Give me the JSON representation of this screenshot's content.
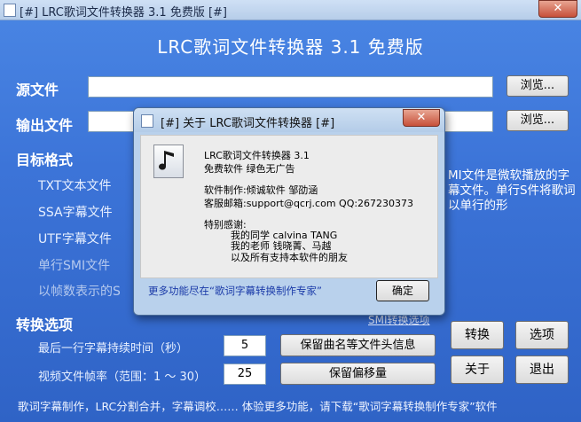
{
  "window": {
    "title": "[#] LRC歌词文件转换器 3.1 免费版 [#]",
    "close_glyph": "✕"
  },
  "app_title": "LRC歌词文件转换器 3.1 免费版",
  "source": {
    "label": "源文件",
    "value": "",
    "browse": "浏览..."
  },
  "output": {
    "label": "输出文件",
    "value": "",
    "browse": "浏览..."
  },
  "target": {
    "label": "目标格式",
    "options": [
      "TXT文本文件",
      "SSA字幕文件",
      "UTF字幕文件",
      "单行SMI文件",
      "以帧数表示的S"
    ]
  },
  "description": "MI文件是微软播放的字幕文件。单行S件将歌词以单行的形",
  "convert_options": {
    "label": "转换选项",
    "smi_link": "SMI转换选项",
    "last_line_label": "最后一行字幕持续时间（秒）",
    "last_line_value": "5",
    "keep_header": "保留曲名等文件头信息",
    "fps_label": "视频文件帧率（范围：1 ～ 30）",
    "fps_value": "25",
    "keep_offset": "保留偏移量"
  },
  "buttons": {
    "convert": "转换",
    "options": "选项",
    "about": "关于",
    "exit": "退出"
  },
  "status_bar": "歌词字幕制作，LRC分割合并，字幕调校…… 体验更多功能，请下载“歌词字幕转换制作专家”软件",
  "dialog": {
    "title": "[#] 关于 LRC歌词文件转换器 [#]",
    "close_glyph": "✕",
    "line1": "LRC歌词文件转换器 3.1",
    "line2": "免费软件 绿色无广告",
    "author": "软件制作:倾诚软件 邹劭涵",
    "contact": "客服邮箱:support@qcrj.com  QQ:267230373",
    "thanks_title": "特别感谢:",
    "thanks": [
      "我的同学 calvina TANG",
      "我的老师 钱晓菁、马越",
      "以及所有支持本软件的朋友"
    ],
    "more_link": "更多功能尽在“歌词字幕转换制作专家”",
    "ok": "确定"
  }
}
